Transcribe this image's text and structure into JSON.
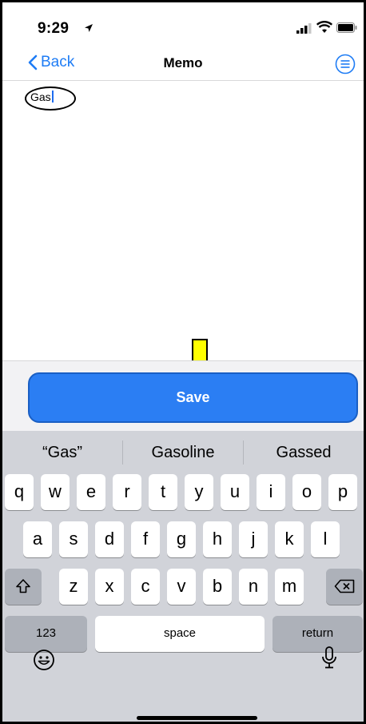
{
  "status_bar": {
    "time": "9:29"
  },
  "nav": {
    "back_label": "Back",
    "title": "Memo"
  },
  "memo": {
    "text": "Gas"
  },
  "save_label": "Save",
  "suggestions": [
    "“Gas”",
    "Gasoline",
    "Gassed"
  ],
  "keyboard": {
    "row1": [
      "q",
      "w",
      "e",
      "r",
      "t",
      "y",
      "u",
      "i",
      "o",
      "p"
    ],
    "row2": [
      "a",
      "s",
      "d",
      "f",
      "g",
      "h",
      "j",
      "k",
      "l"
    ],
    "row3": [
      "z",
      "x",
      "c",
      "v",
      "b",
      "n",
      "m"
    ],
    "numbers_label": "123",
    "space_label": "space",
    "return_label": "return"
  },
  "colors": {
    "accent": "#2b7ef3",
    "arrow_fill": "#ffff00",
    "keyboard_bg": "#d1d3d9"
  },
  "icons": [
    "location-arrow-icon",
    "signal-icon",
    "wifi-icon",
    "battery-icon",
    "chevron-left-icon",
    "menu-icon",
    "down-arrow-icon",
    "shift-icon",
    "backspace-icon",
    "emoji-icon",
    "microphone-icon"
  ]
}
